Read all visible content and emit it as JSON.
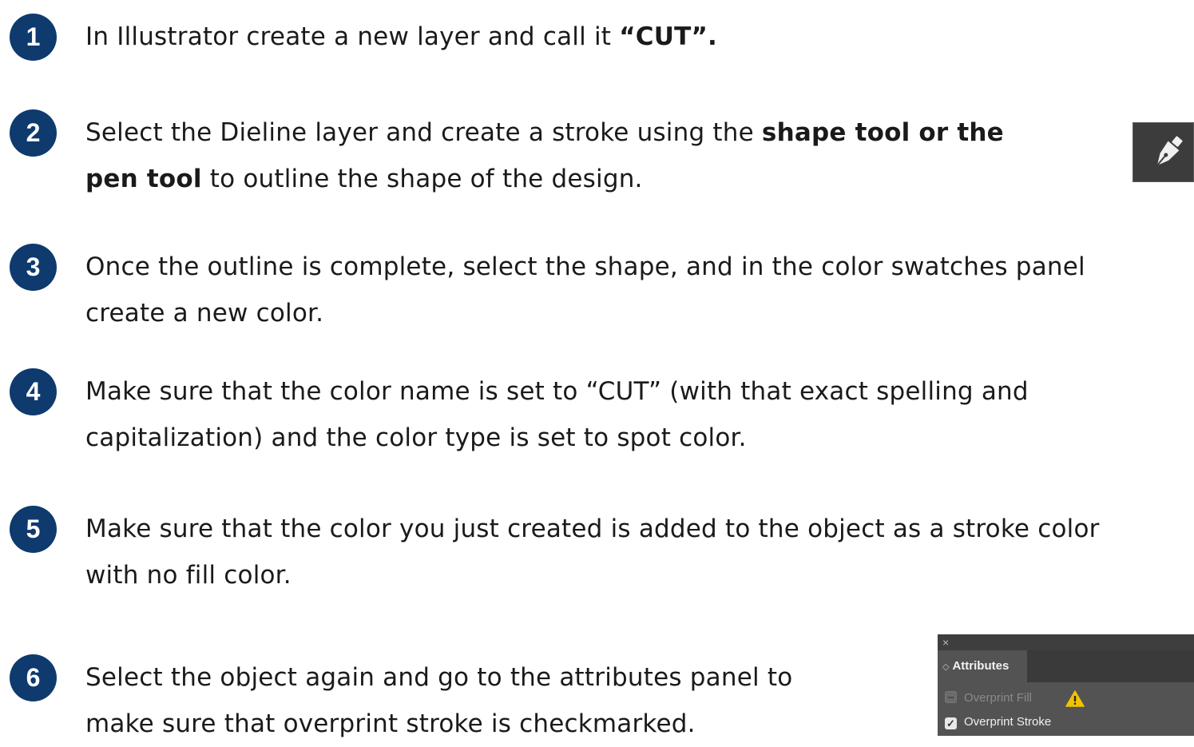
{
  "steps": [
    {
      "number": "1",
      "line1_pre": "In Illustrator create a new layer and call it ",
      "line1_bold": "“CUT”."
    },
    {
      "number": "2",
      "line1_pre": "Select the Dieline layer and create a stroke using the ",
      "line1_bold": "shape tool or the",
      "line2_bold": "pen tool",
      "line2_post": " to outline the shape of the design."
    },
    {
      "number": "3",
      "line1": "Once the outline is complete, select the shape, and in the color swatches panel",
      "line2": "create a new color."
    },
    {
      "number": "4",
      "line1": "Make sure that the color name is set to “CUT” (with that exact spelling and",
      "line2": "capitalization) and the color type is set to spot color."
    },
    {
      "number": "5",
      "line1": "Make sure that the color you just created is added to the object as a stroke color",
      "line2": "with no fill color."
    },
    {
      "number": "6",
      "line1": "Select the object again and go to the attributes panel to",
      "line2": "make sure that overprint stroke is checkmarked."
    }
  ],
  "pen_tool": {
    "icon": "pen-tool-icon",
    "bg": "#3c3c3c"
  },
  "attributes_panel": {
    "close": "×",
    "tab_label": "Attributes",
    "overprint_fill": "Overprint Fill",
    "overprint_stroke": "Overprint Stroke",
    "overprint_fill_checked": false,
    "overprint_stroke_checked": true,
    "warning_icon": "warning-icon"
  },
  "colors": {
    "badge": "#0e3a6e",
    "text": "#1a1a1a",
    "panel": "#535353",
    "warning": "#f2c200"
  }
}
